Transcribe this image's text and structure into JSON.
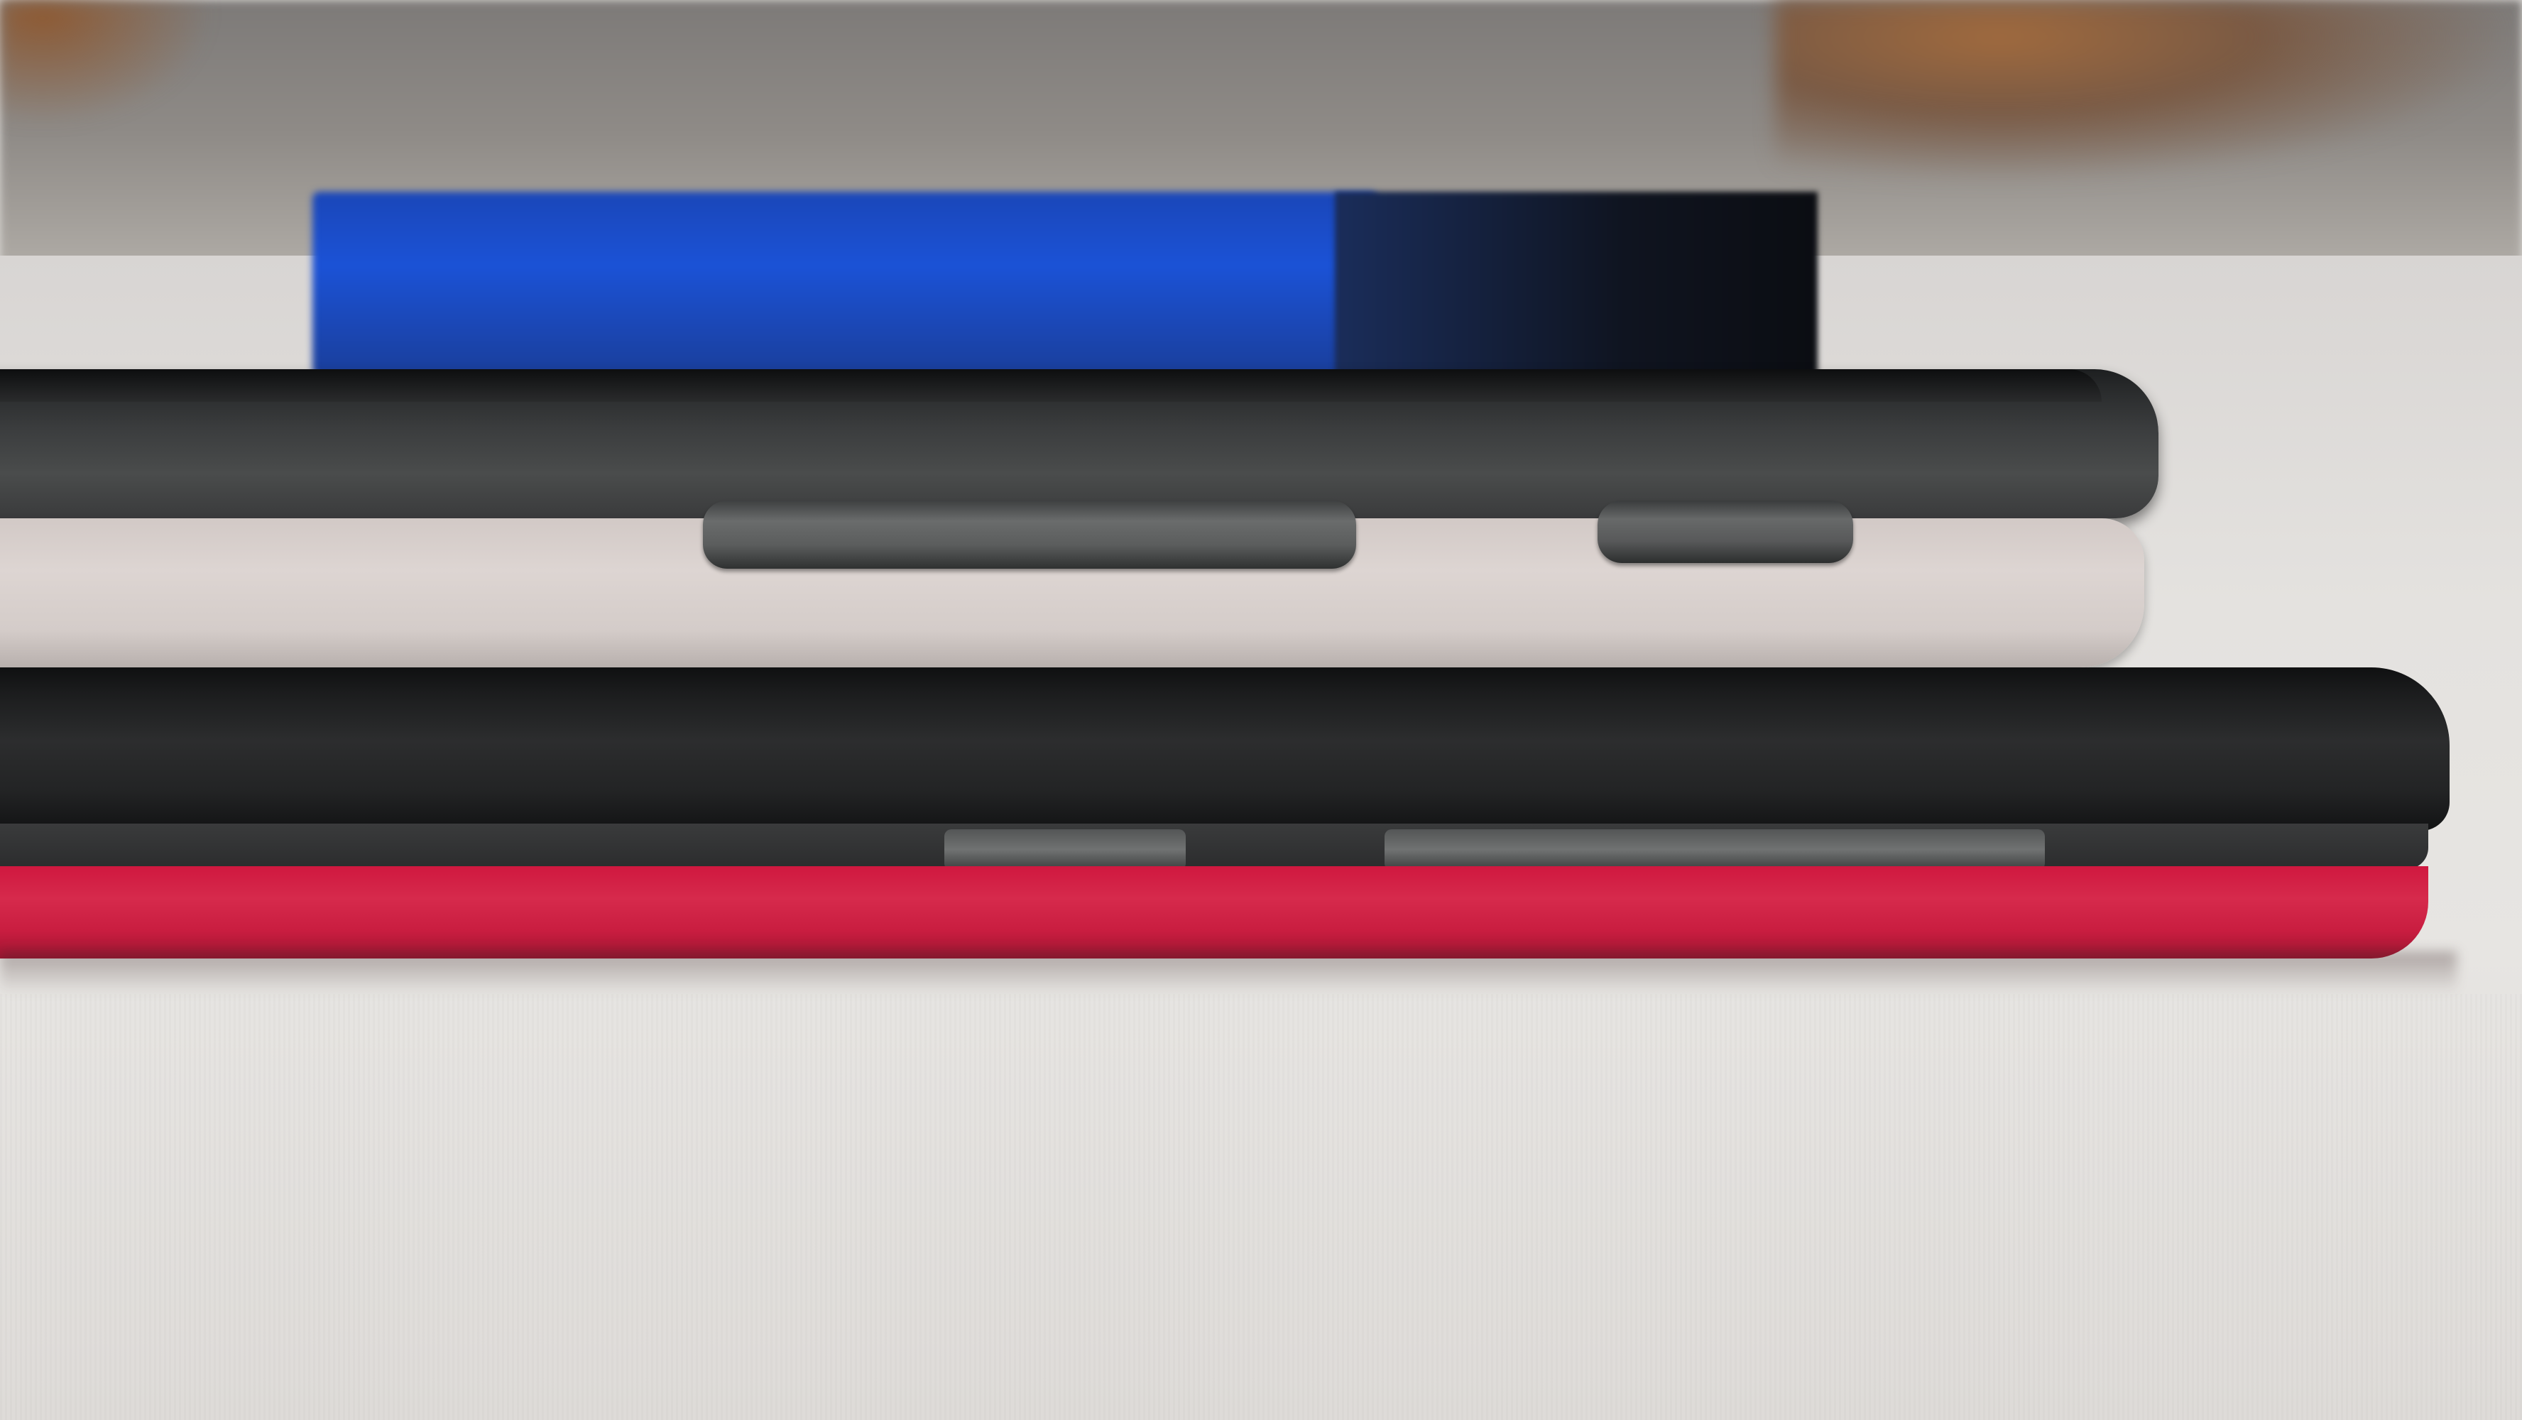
{
  "photo": {
    "subject": "stacked-phones-side-view",
    "colors": {
      "table": "#e4e2df",
      "screen_blue": "#1b52d6",
      "top_phone_frame": "#3b3d3e",
      "white_phone": "#ddd5d2",
      "black_phone": "#2c2d2e",
      "red_back": "#d62a4c",
      "buttons": "#6a6c6c"
    }
  }
}
